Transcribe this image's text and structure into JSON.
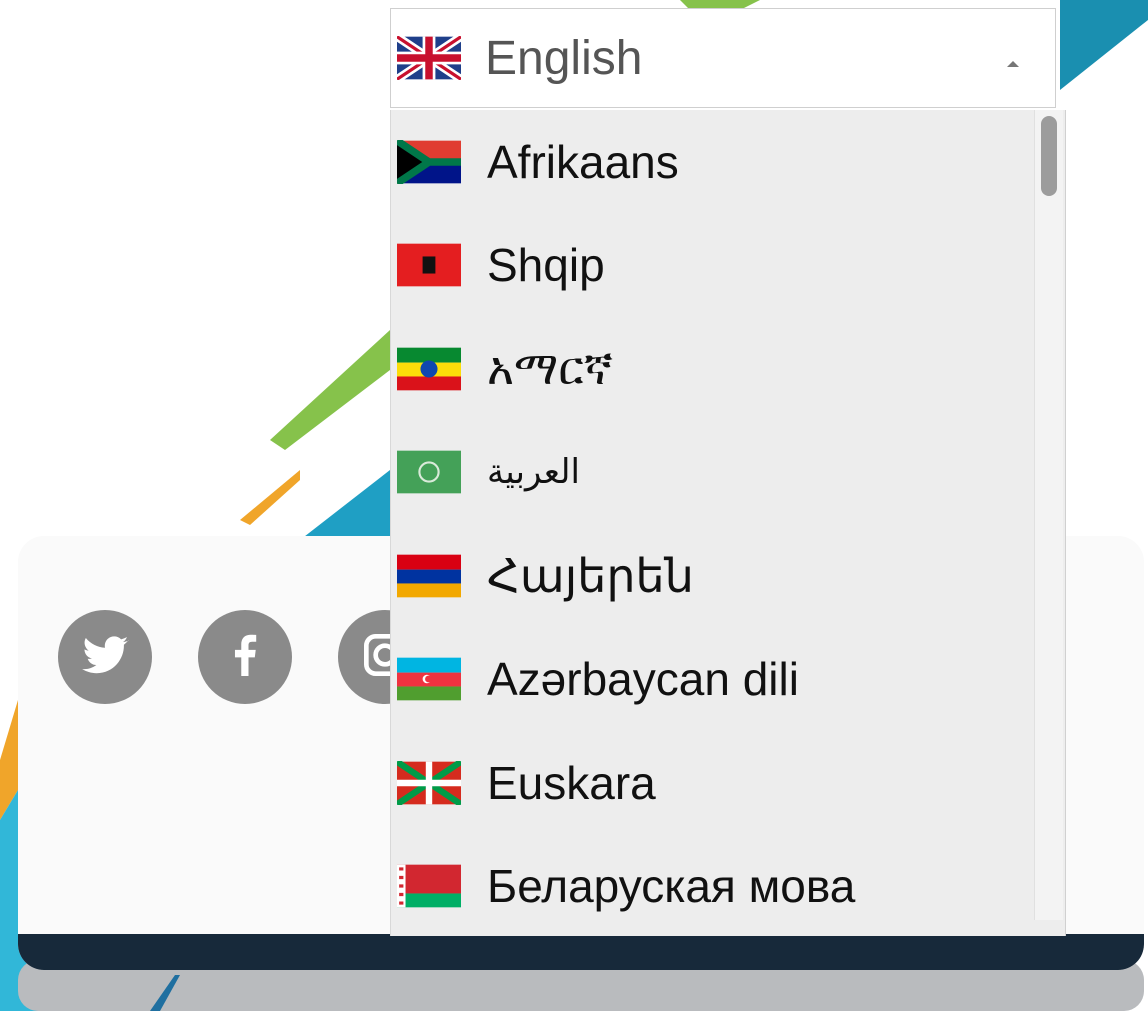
{
  "colors": {
    "footer_bar": "#17293a",
    "social_icon": "#8a8a8a",
    "dropdown_bg": "#ededed",
    "accent_blue": "#1f9fc4",
    "accent_green": "#86c24b",
    "accent_orange": "#f0a52a"
  },
  "language_selector": {
    "selected_label": "English",
    "selected_flag_icon": "uk-flag-icon",
    "caret_icon": "caret-up-icon",
    "options": [
      {
        "label": "Afrikaans",
        "flag_icon": "south-africa-flag-icon"
      },
      {
        "label": "Shqip",
        "flag_icon": "albania-flag-icon"
      },
      {
        "label": "አማርኛ",
        "flag_icon": "ethiopia-flag-icon"
      },
      {
        "label": "العربية",
        "flag_icon": "arab-league-flag-icon"
      },
      {
        "label": "Հայերեն",
        "flag_icon": "armenia-flag-icon"
      },
      {
        "label": "Azərbaycan dili",
        "flag_icon": "azerbaijan-flag-icon"
      },
      {
        "label": "Euskara",
        "flag_icon": "basque-flag-icon"
      },
      {
        "label": "Беларуская мова",
        "flag_icon": "belarus-flag-icon"
      }
    ]
  },
  "social_icons": [
    {
      "name": "twitter-icon"
    },
    {
      "name": "facebook-icon"
    },
    {
      "name": "instagram-icon"
    }
  ]
}
